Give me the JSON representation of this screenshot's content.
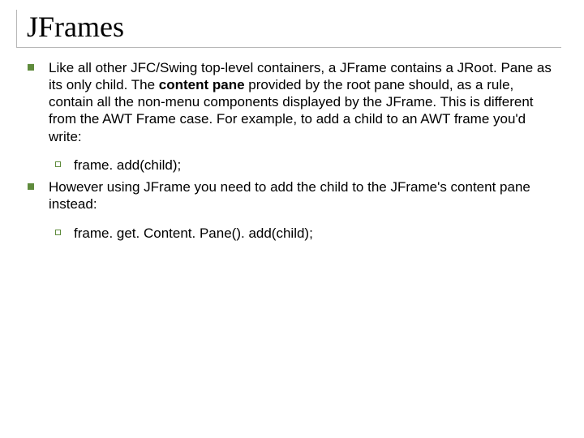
{
  "title": "JFrames",
  "b1_pre": "Like all other JFC/Swing top-level containers, a JFrame contains a JRoot. Pane as its only child. The ",
  "b1_bold": "content pane",
  "b1_post": " provided by the root pane should, as a rule, contain all the non-menu components displayed by the JFrame. This is different from the AWT Frame case. For example, to add a child to an AWT frame you'd write:",
  "b1_sub1": "frame. add(child);",
  "b2_text": "However using JFrame you need to add the child to the JFrame's content pane instead:",
  "b2_sub1": "frame. get. Content. Pane(). add(child);"
}
